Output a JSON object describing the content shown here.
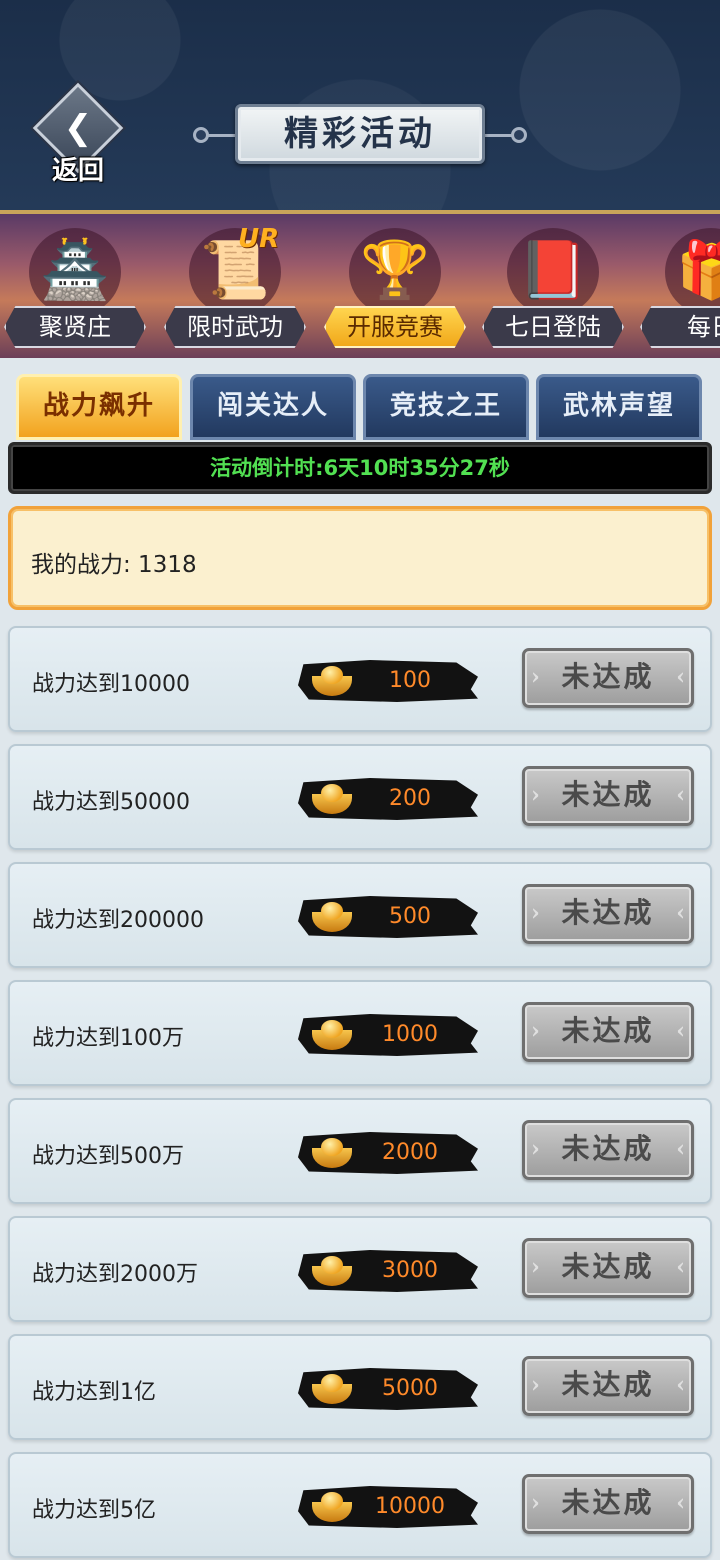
{
  "header": {
    "back_label": "返回",
    "back_icon": "chevron-left-icon",
    "title": "精彩活动"
  },
  "nav": {
    "items": [
      {
        "label": "聚贤庄",
        "icon": "palace-icon",
        "glyph": "🏯"
      },
      {
        "label": "限时武功",
        "icon": "scroll-icon",
        "glyph": "📜",
        "badge": "UR"
      },
      {
        "label": "开服竞赛",
        "icon": "trophy-icon",
        "glyph": "🏆",
        "active": true
      },
      {
        "label": "七日登陆",
        "icon": "book-icon",
        "glyph": "📕"
      },
      {
        "label": "每日",
        "icon": "gift-icon",
        "glyph": "🎁"
      }
    ]
  },
  "tabs": [
    {
      "label": "战力飙升",
      "active": true
    },
    {
      "label": "闯关达人"
    },
    {
      "label": "竞技之王"
    },
    {
      "label": "武林声望"
    }
  ],
  "countdown": "活动倒计时:6天10时35分27秒",
  "my_power": "我的战力: 1318",
  "rows": [
    {
      "label": "战力达到10000",
      "reward": "100",
      "status": "未达成"
    },
    {
      "label": "战力达到50000",
      "reward": "200",
      "status": "未达成"
    },
    {
      "label": "战力达到200000",
      "reward": "500",
      "status": "未达成"
    },
    {
      "label": "战力达到100万",
      "reward": "1000",
      "status": "未达成"
    },
    {
      "label": "战力达到500万",
      "reward": "2000",
      "status": "未达成"
    },
    {
      "label": "战力达到2000万",
      "reward": "3000",
      "status": "未达成"
    },
    {
      "label": "战力达到1亿",
      "reward": "5000",
      "status": "未达成"
    },
    {
      "label": "战力达到5亿",
      "reward": "10000",
      "status": "未达成"
    }
  ],
  "colors": {
    "header_bg": "#1f3350",
    "countdown_text": "#52e052",
    "reward_text": "#ff8a2a",
    "active_tab": "#f2a21e"
  }
}
